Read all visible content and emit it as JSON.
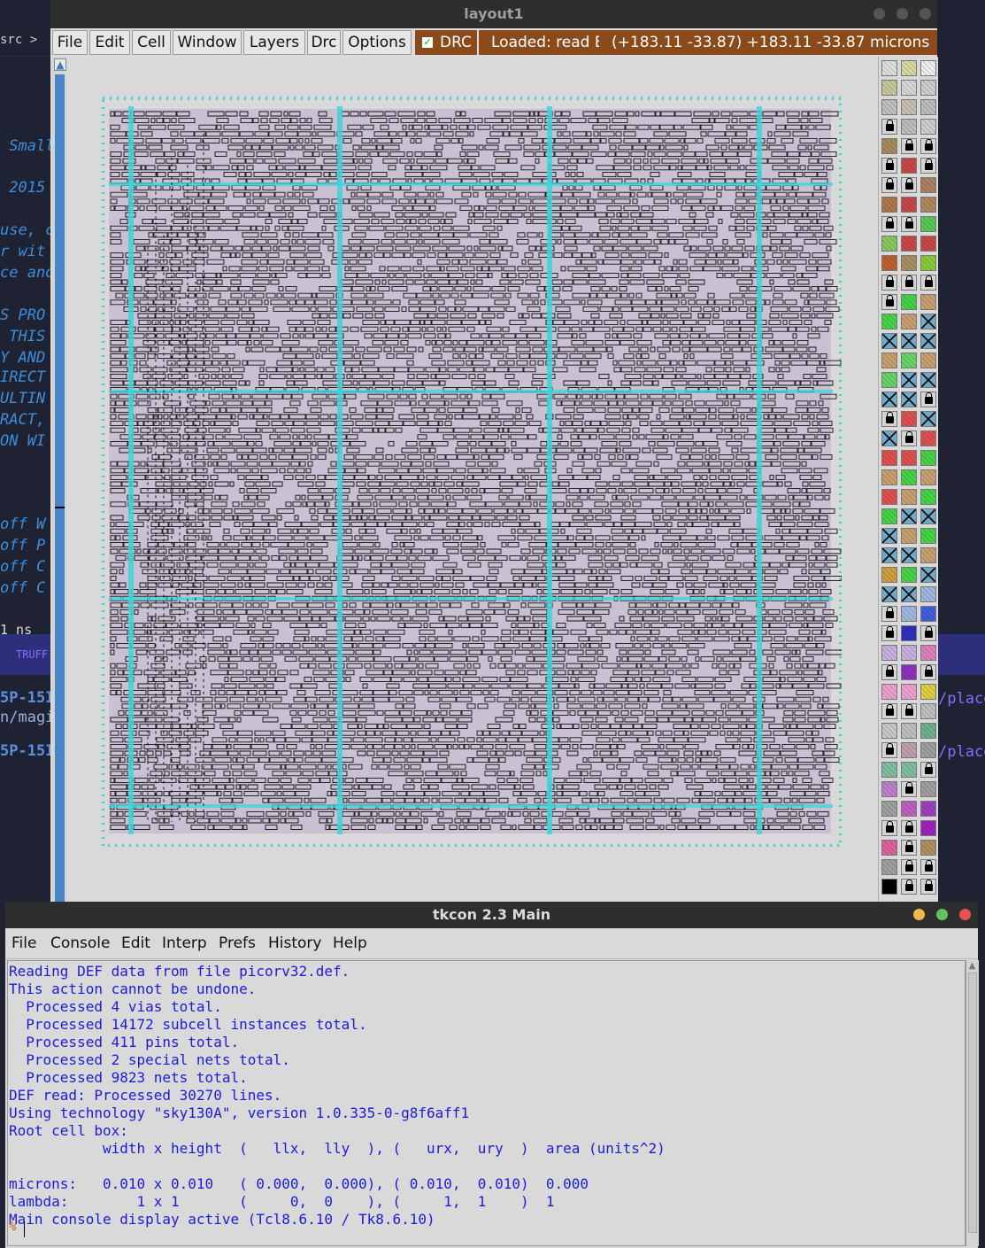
{
  "background": {
    "editor_path": "src >  ≡",
    "editor_lines": [
      " Small",
      " 2015",
      "use, c",
      "r wit",
      "ce and",
      "S PRO",
      " THIS",
      "Y AND",
      "IRECT",
      "ULTIN",
      "RACT,",
      "ON WI",
      "off W",
      "off P",
      "off C",
      "off C",
      "1 ns"
    ],
    "status_label": "TRUFF",
    "terminal_left": [
      "5P-15I",
      "n/magi",
      "5P-15I"
    ],
    "terminal_right": [
      "/place",
      "/place"
    ]
  },
  "layout_window": {
    "title": "layout1",
    "menu": [
      "File",
      "Edit",
      "Cell",
      "Window",
      "Layers",
      "Drc",
      "Options"
    ],
    "drc_label": "DRC",
    "status_loaded": "Loaded: read E",
    "status_coords": "(+183.11 -33.87) +183.11 -33.87 microns"
  },
  "tkcon": {
    "title": "tkcon 2.3 Main",
    "menu": [
      "File",
      "Console",
      "Edit",
      "Interp",
      "Prefs",
      "History",
      "Help"
    ],
    "lines": [
      "Reading DEF data from file picorv32.def.",
      "This action cannot be undone.",
      "  Processed 4 vias total.",
      "  Processed 14172 subcell instances total.",
      "  Processed 411 pins total.",
      "  Processed 2 special nets total.",
      "  Processed 9823 nets total.",
      "DEF read: Processed 30270 lines.",
      "Using technology \"sky130A\", version 1.0.335-0-g8f6aff1",
      "Root cell box:",
      "           width x height  (   llx,  lly  ), (   urx,  ury  )  area (units^2)",
      "",
      "microns:   0.010 x 0.010   ( 0.000,  0.000), ( 0.010,  0.010)  0.000",
      "lambda:        1 x 1       (     0,  0    ), (     1,  1    )  1",
      "Main console display active (Tcl8.6.10 / Tk8.6.10)"
    ],
    "prompt": "%"
  },
  "colors": {
    "drc_bg": "#8b4a1a",
    "console_text": "#1c1cd6",
    "cell_fill": "#c9c0d4",
    "power_rail": "#3cd4d8"
  }
}
